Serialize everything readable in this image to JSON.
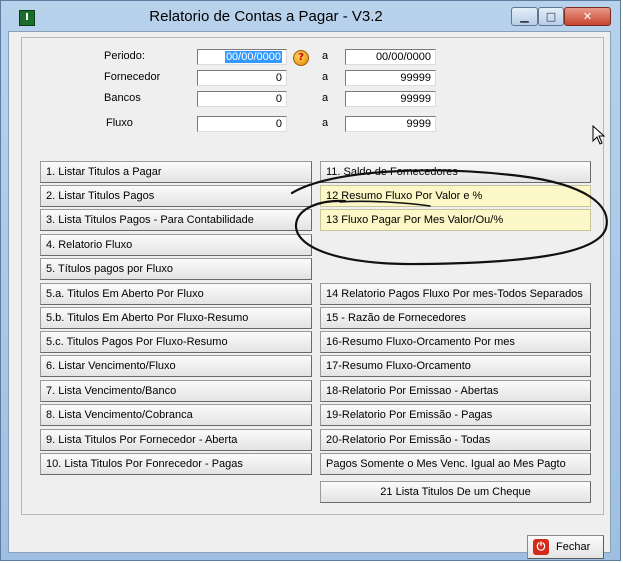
{
  "window": {
    "title": "Relatorio de Contas a Pagar - V3.2",
    "app_icon": "I",
    "minimize": "▁",
    "maximize": "□",
    "close": "✕"
  },
  "filters": {
    "separator": "a",
    "periodo": {
      "label": "Periodo:",
      "from": "00/00/0000",
      "to": "00/00/0000"
    },
    "fornecedor": {
      "label": "Fornecedor",
      "from": "0",
      "to": "99999"
    },
    "bancos": {
      "label": "Bancos",
      "from": "0",
      "to": "99999"
    },
    "fluxo": {
      "label": "Fluxo",
      "from": "0",
      "to": "9999"
    },
    "help": "?"
  },
  "left_buttons": [
    "1. Listar Titulos a Pagar",
    "2. Listar Titulos Pagos",
    "3. Lista Titulos Pagos - Para Contabilidade",
    "4. Relatorio Fluxo",
    "5. Títulos pagos por Fluxo",
    "5.a. Titulos Em Aberto Por Fluxo",
    "5.b. Titulos Em Aberto Por Fluxo-Resumo",
    "5.c. Titulos Pagos Por Fluxo-Resumo",
    "6. Listar Vencimento/Fluxo",
    "7. Lista Vencimento/Banco",
    "8. Lista Vencimento/Cobranca",
    "9. Lista Titulos Por Fornecedor - Aberta",
    "10. Lista Titulos Por Fonrecedor - Pagas"
  ],
  "right_buttons": [
    "11. Saldo de Fornecedores",
    "12 Resumo Fluxo Por Valor e %",
    "13 Fluxo Pagar Por Mes Valor/Ou/%",
    "14 Relatorio Pagos Fluxo Por mes-Todos Separados",
    "15 - Razão de Fornecedores",
    "16-Resumo Fluxo-Orcamento Por mes",
    "17-Resumo Fluxo-Orcamento",
    "18-Relatorio Por Emissao - Abertas",
    "19-Relatorio Por Emissão - Pagas",
    "20-Relatorio Por Emissão - Todas",
    "Pagos Somente o Mes Venc. Igual ao Mes Pagto",
    "21 Lista Titulos De um Cheque"
  ],
  "footer": {
    "close_label": "Fechar"
  },
  "colors": {
    "titlebar": "#b8d2ec",
    "highlight_button": "#fbf7c6",
    "close_red": "#d42a1a"
  }
}
